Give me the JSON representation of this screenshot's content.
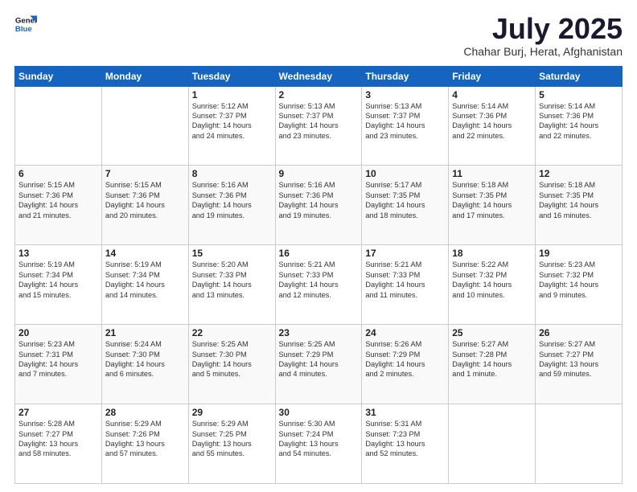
{
  "header": {
    "logo_line1": "General",
    "logo_line2": "Blue",
    "month": "July 2025",
    "location": "Chahar Burj, Herat, Afghanistan"
  },
  "days_of_week": [
    "Sunday",
    "Monday",
    "Tuesday",
    "Wednesday",
    "Thursday",
    "Friday",
    "Saturday"
  ],
  "weeks": [
    [
      {
        "day": "",
        "text": ""
      },
      {
        "day": "",
        "text": ""
      },
      {
        "day": "1",
        "text": "Sunrise: 5:12 AM\nSunset: 7:37 PM\nDaylight: 14 hours\nand 24 minutes."
      },
      {
        "day": "2",
        "text": "Sunrise: 5:13 AM\nSunset: 7:37 PM\nDaylight: 14 hours\nand 23 minutes."
      },
      {
        "day": "3",
        "text": "Sunrise: 5:13 AM\nSunset: 7:37 PM\nDaylight: 14 hours\nand 23 minutes."
      },
      {
        "day": "4",
        "text": "Sunrise: 5:14 AM\nSunset: 7:36 PM\nDaylight: 14 hours\nand 22 minutes."
      },
      {
        "day": "5",
        "text": "Sunrise: 5:14 AM\nSunset: 7:36 PM\nDaylight: 14 hours\nand 22 minutes."
      }
    ],
    [
      {
        "day": "6",
        "text": "Sunrise: 5:15 AM\nSunset: 7:36 PM\nDaylight: 14 hours\nand 21 minutes."
      },
      {
        "day": "7",
        "text": "Sunrise: 5:15 AM\nSunset: 7:36 PM\nDaylight: 14 hours\nand 20 minutes."
      },
      {
        "day": "8",
        "text": "Sunrise: 5:16 AM\nSunset: 7:36 PM\nDaylight: 14 hours\nand 19 minutes."
      },
      {
        "day": "9",
        "text": "Sunrise: 5:16 AM\nSunset: 7:36 PM\nDaylight: 14 hours\nand 19 minutes."
      },
      {
        "day": "10",
        "text": "Sunrise: 5:17 AM\nSunset: 7:35 PM\nDaylight: 14 hours\nand 18 minutes."
      },
      {
        "day": "11",
        "text": "Sunrise: 5:18 AM\nSunset: 7:35 PM\nDaylight: 14 hours\nand 17 minutes."
      },
      {
        "day": "12",
        "text": "Sunrise: 5:18 AM\nSunset: 7:35 PM\nDaylight: 14 hours\nand 16 minutes."
      }
    ],
    [
      {
        "day": "13",
        "text": "Sunrise: 5:19 AM\nSunset: 7:34 PM\nDaylight: 14 hours\nand 15 minutes."
      },
      {
        "day": "14",
        "text": "Sunrise: 5:19 AM\nSunset: 7:34 PM\nDaylight: 14 hours\nand 14 minutes."
      },
      {
        "day": "15",
        "text": "Sunrise: 5:20 AM\nSunset: 7:33 PM\nDaylight: 14 hours\nand 13 minutes."
      },
      {
        "day": "16",
        "text": "Sunrise: 5:21 AM\nSunset: 7:33 PM\nDaylight: 14 hours\nand 12 minutes."
      },
      {
        "day": "17",
        "text": "Sunrise: 5:21 AM\nSunset: 7:33 PM\nDaylight: 14 hours\nand 11 minutes."
      },
      {
        "day": "18",
        "text": "Sunrise: 5:22 AM\nSunset: 7:32 PM\nDaylight: 14 hours\nand 10 minutes."
      },
      {
        "day": "19",
        "text": "Sunrise: 5:23 AM\nSunset: 7:32 PM\nDaylight: 14 hours\nand 9 minutes."
      }
    ],
    [
      {
        "day": "20",
        "text": "Sunrise: 5:23 AM\nSunset: 7:31 PM\nDaylight: 14 hours\nand 7 minutes."
      },
      {
        "day": "21",
        "text": "Sunrise: 5:24 AM\nSunset: 7:30 PM\nDaylight: 14 hours\nand 6 minutes."
      },
      {
        "day": "22",
        "text": "Sunrise: 5:25 AM\nSunset: 7:30 PM\nDaylight: 14 hours\nand 5 minutes."
      },
      {
        "day": "23",
        "text": "Sunrise: 5:25 AM\nSunset: 7:29 PM\nDaylight: 14 hours\nand 4 minutes."
      },
      {
        "day": "24",
        "text": "Sunrise: 5:26 AM\nSunset: 7:29 PM\nDaylight: 14 hours\nand 2 minutes."
      },
      {
        "day": "25",
        "text": "Sunrise: 5:27 AM\nSunset: 7:28 PM\nDaylight: 14 hours\nand 1 minute."
      },
      {
        "day": "26",
        "text": "Sunrise: 5:27 AM\nSunset: 7:27 PM\nDaylight: 13 hours\nand 59 minutes."
      }
    ],
    [
      {
        "day": "27",
        "text": "Sunrise: 5:28 AM\nSunset: 7:27 PM\nDaylight: 13 hours\nand 58 minutes."
      },
      {
        "day": "28",
        "text": "Sunrise: 5:29 AM\nSunset: 7:26 PM\nDaylight: 13 hours\nand 57 minutes."
      },
      {
        "day": "29",
        "text": "Sunrise: 5:29 AM\nSunset: 7:25 PM\nDaylight: 13 hours\nand 55 minutes."
      },
      {
        "day": "30",
        "text": "Sunrise: 5:30 AM\nSunset: 7:24 PM\nDaylight: 13 hours\nand 54 minutes."
      },
      {
        "day": "31",
        "text": "Sunrise: 5:31 AM\nSunset: 7:23 PM\nDaylight: 13 hours\nand 52 minutes."
      },
      {
        "day": "",
        "text": ""
      },
      {
        "day": "",
        "text": ""
      }
    ]
  ]
}
